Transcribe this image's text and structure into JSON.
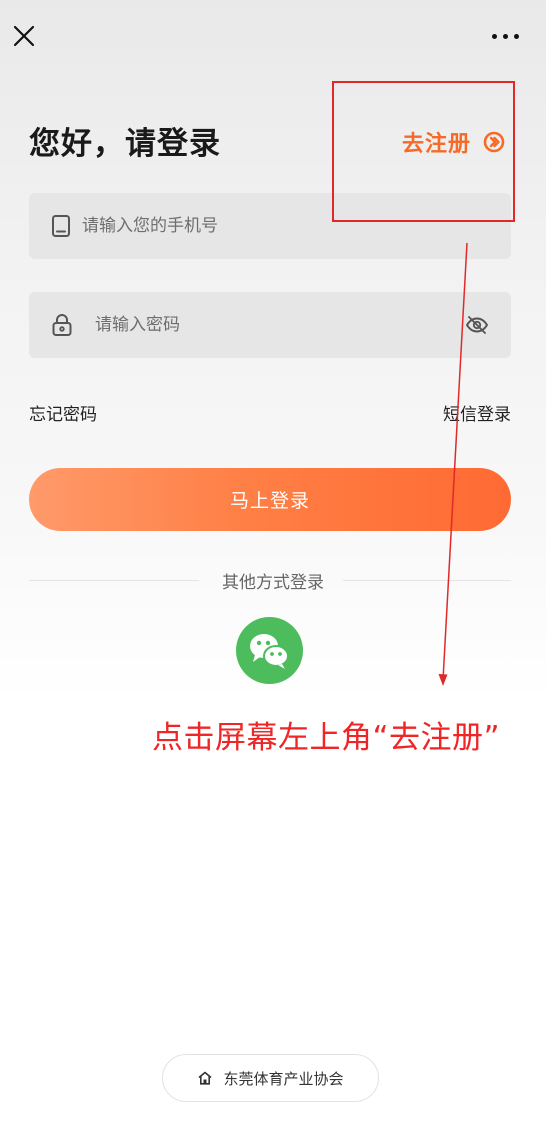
{
  "header": {
    "close_icon": "close-icon",
    "more_icon": "more-icon"
  },
  "login": {
    "title": "您好，请登录",
    "register_label": "去注册",
    "register_icon": "arrow-circle-right-icon",
    "phone_placeholder": "请输入您的手机号",
    "password_placeholder": "请输入密码",
    "forgot_label": "忘记密码",
    "sms_label": "短信登录",
    "submit_label": "马上登录",
    "other_label": "其他方式登录",
    "wechat_icon": "wechat-icon"
  },
  "annotation": {
    "text": "点击屏幕左上角“去注册”"
  },
  "footer": {
    "label": "东莞体育产业协会",
    "icon": "home-icon"
  },
  "colors": {
    "accent": "#f46a26",
    "button_start": "#ff9a6a",
    "button_end": "#ff6a33",
    "wechat": "#4cbc5c",
    "annotation": "#e02a2a"
  }
}
